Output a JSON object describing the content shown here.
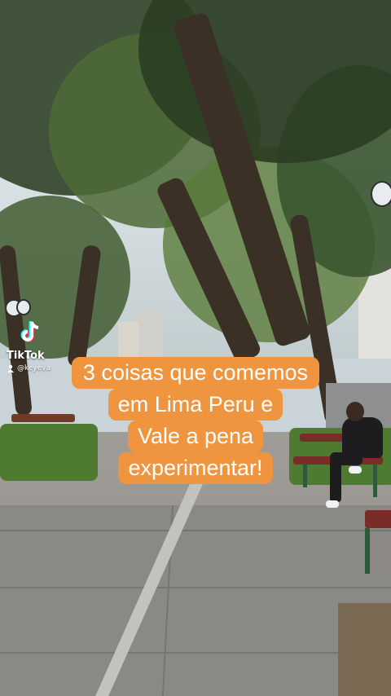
{
  "watermark": {
    "brand": "TikTok",
    "handle": "@keyeva",
    "logo_icon": "tiktok-logo-icon",
    "user_icon": "user-icon"
  },
  "caption": {
    "lines": [
      "3 coisas que comemos",
      "em Lima Peru e",
      "Vale a pena",
      "experimentar!"
    ],
    "background_color": "#f0953f",
    "text_color": "#ffffff"
  }
}
